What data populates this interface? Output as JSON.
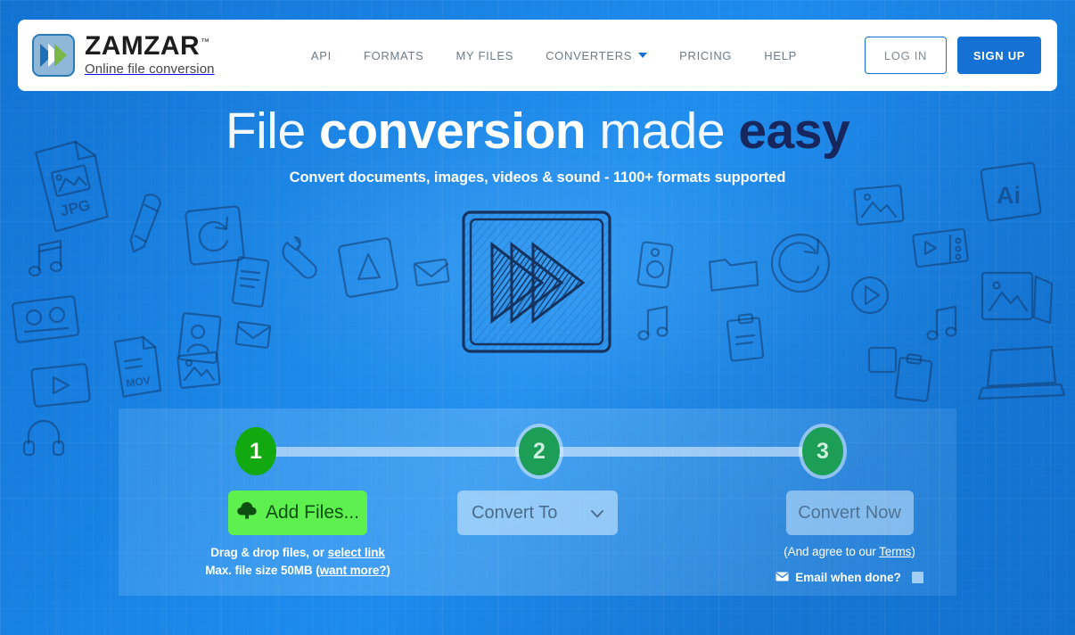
{
  "brand": {
    "name": "ZAMZAR",
    "trademark": "™",
    "tagline": "Online file conversion",
    "logo_icon": "double-chevron-logo-icon",
    "colors": {
      "logo_blue": "#1f6fb8",
      "logo_green": "#7ab648",
      "logo_frame": "#8fb8d8"
    }
  },
  "nav": {
    "items": [
      {
        "label": "API",
        "has_dropdown": false
      },
      {
        "label": "FORMATS",
        "has_dropdown": false
      },
      {
        "label": "MY FILES",
        "has_dropdown": false
      },
      {
        "label": "CONVERTERS",
        "has_dropdown": true
      },
      {
        "label": "PRICING",
        "has_dropdown": false
      },
      {
        "label": "HELP",
        "has_dropdown": false
      }
    ],
    "login_label": "LOG IN",
    "signup_label": "SIGN UP",
    "accent_color": "#1571d4"
  },
  "hero": {
    "headline_part1": "File ",
    "headline_part2": "conversion",
    "headline_part3": " made ",
    "headline_part4": "easy",
    "subhead": "Convert documents, images, videos & sound - 1100+ formats supported",
    "illustration_icon": "fast-forward-sketch-icon",
    "easy_color": "#17275e"
  },
  "converter": {
    "steps": [
      {
        "number": "1",
        "state": "active"
      },
      {
        "number": "2",
        "state": "inactive"
      },
      {
        "number": "3",
        "state": "inactive"
      }
    ],
    "step_active_color": "#11a810",
    "step_inactive_color": "#1d9e57",
    "add_files": {
      "label": "Add Files...",
      "icon": "cloud-upload-icon",
      "color": "#5ef04e",
      "text_color": "#0c4f10"
    },
    "convert_to": {
      "label": "Convert To",
      "icon": "chevron-down-icon"
    },
    "convert_now": {
      "label": "Convert Now"
    },
    "hints": {
      "drag_prefix": "Drag & drop files, or ",
      "drag_link": "select link",
      "size_prefix": "Max. file size 50MB (",
      "size_link": "want more?",
      "size_suffix": ")"
    },
    "terms": {
      "prefix": "(And agree to our ",
      "link": "Terms",
      "suffix": ")"
    },
    "email_option": {
      "icon": "envelope-icon",
      "label": "Email when done?",
      "checked": false
    }
  },
  "background": {
    "base_color": "#1577d6",
    "doodle_stroke": "#123a6b",
    "doodle_labels": {
      "jpg": "JPG",
      "ai": "Ai",
      "mov": "MOV"
    }
  }
}
